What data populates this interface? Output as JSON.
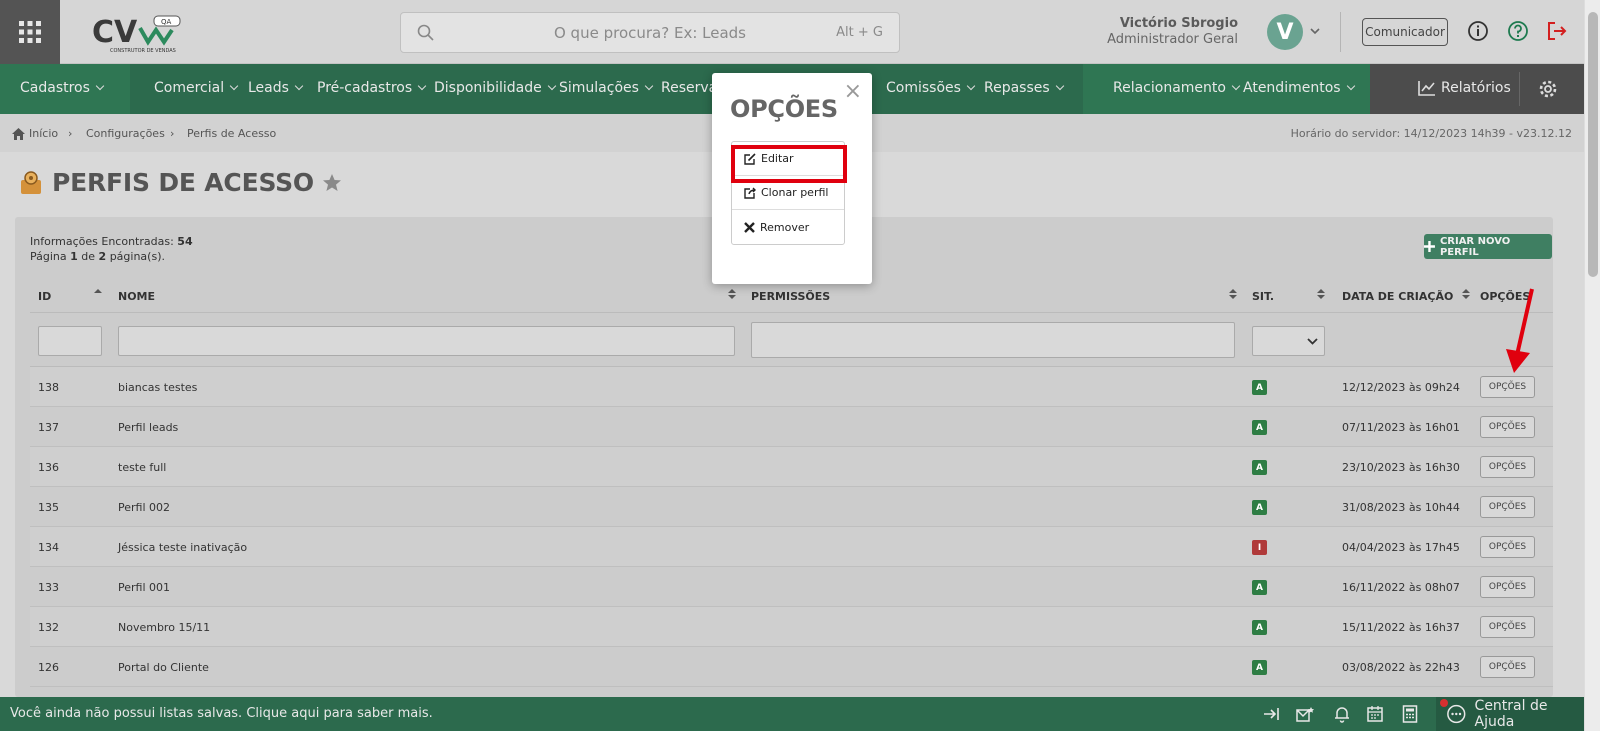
{
  "app": {
    "search_placeholder": "O que procura? Ex: Leads",
    "search_shortcut": "Alt + G"
  },
  "user": {
    "name": "Victório Sbrogio",
    "role": "Administrador Geral",
    "initial": "V"
  },
  "header": {
    "communicator": "Comunicador"
  },
  "nav": [
    {
      "label": "Cadastros"
    },
    {
      "label": "Comercial"
    },
    {
      "label": "Leads"
    },
    {
      "label": "Pré-cadastros"
    },
    {
      "label": "Disponibilidade"
    },
    {
      "label": "Simulações"
    },
    {
      "label": "Reservas"
    },
    {
      "label": "Comissões"
    },
    {
      "label": "Repasses"
    },
    {
      "label": "Relacionamento"
    },
    {
      "label": "Atendimentos"
    },
    {
      "label": "Relatórios"
    }
  ],
  "breadcrumb": {
    "home": "Início",
    "b1": "Configurações",
    "b2": "Perfis de Acesso",
    "server": "Horário do servidor: 14/12/2023 14h39 - v23.12.12"
  },
  "page": {
    "title": "PERFIS DE ACESSO"
  },
  "summary": {
    "found_label": "Informações Encontradas:",
    "found": "54",
    "pg_prefix": "Página",
    "pg_cur": "1",
    "pg_mid": "de",
    "pg_total": "2",
    "pg_suffix": "página(s)."
  },
  "actions": {
    "create": "CRIAR NOVO PERFIL"
  },
  "table": {
    "headers": {
      "id": "ID",
      "nome": "NOME",
      "perm": "PERMISSÕES",
      "sit": "SIT.",
      "data": "DATA DE CRIAÇÃO",
      "opcoes": "OPÇÕES"
    },
    "option_label": "OPÇÕES",
    "rows": [
      {
        "id": "138",
        "nome": "biancas testes",
        "sit": "A",
        "data": "12/12/2023 às 09h24"
      },
      {
        "id": "137",
        "nome": "Perfil leads",
        "sit": "A",
        "data": "07/11/2023 às 16h01"
      },
      {
        "id": "136",
        "nome": "teste full",
        "sit": "A",
        "data": "23/10/2023 às 16h30"
      },
      {
        "id": "135",
        "nome": "Perfil 002",
        "sit": "A",
        "data": "31/08/2023 às 10h44"
      },
      {
        "id": "134",
        "nome": "Jéssica teste inativação",
        "sit": "I",
        "data": "04/04/2023 às 17h45"
      },
      {
        "id": "133",
        "nome": "Perfil 001",
        "sit": "A",
        "data": "16/11/2022 às 08h07"
      },
      {
        "id": "132",
        "nome": "Novembro 15/11",
        "sit": "A",
        "data": "15/11/2022 às 16h37"
      },
      {
        "id": "126",
        "nome": "Portal do Cliente",
        "sit": "A",
        "data": "03/08/2022 às 22h43"
      }
    ]
  },
  "modal": {
    "title": "OPÇÕES",
    "close": "×",
    "items": [
      {
        "label": "Editar"
      },
      {
        "label": "Clonar perfil"
      },
      {
        "label": "Remover"
      }
    ]
  },
  "bottom": {
    "message": "Você ainda não possui listas salvas. Clique aqui para saber mais.",
    "help": "Central de Ajuda"
  },
  "colors": {
    "nav": "#2c6a4d",
    "badge_active": "#2e7d44",
    "badge_inactive": "#b03a3a",
    "highlight": "#e0000e"
  }
}
